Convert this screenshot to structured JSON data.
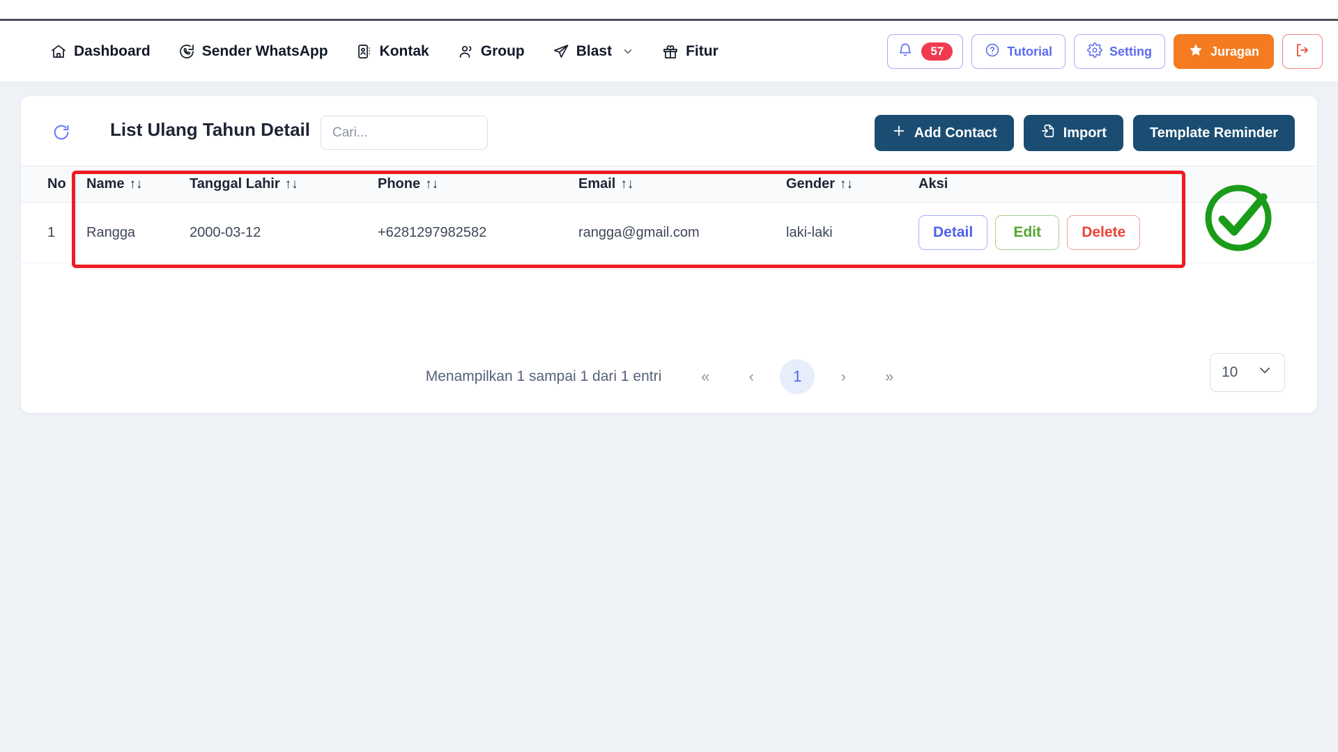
{
  "navbar": {
    "items": [
      {
        "label": "Dashboard",
        "icon": "home-icon",
        "caret": false
      },
      {
        "label": "Sender WhatsApp",
        "icon": "whatsapp-icon",
        "caret": false
      },
      {
        "label": "Kontak",
        "icon": "contact-card-icon",
        "caret": false
      },
      {
        "label": "Group",
        "icon": "people-icon",
        "caret": false
      },
      {
        "label": "Blast",
        "icon": "send-icon",
        "caret": true
      },
      {
        "label": "Fitur",
        "icon": "gift-icon",
        "caret": false
      }
    ],
    "notification": {
      "icon": "bell-icon",
      "count": "57"
    },
    "tutorial": {
      "icon": "question-circle-icon",
      "label": "Tutorial"
    },
    "setting": {
      "icon": "gear-icon",
      "label": "Setting"
    },
    "juragan": {
      "icon": "star-icon",
      "label": "Juragan"
    },
    "logout": {
      "icon": "logout-icon",
      "label": ""
    }
  },
  "toolbar": {
    "refresh_icon": "refresh-icon",
    "title": "List Ulang Tahun Detail",
    "search_placeholder": "Cari...",
    "search_value": "",
    "add_contact": "Add Contact",
    "import": "Import",
    "template_reminder": "Template Reminder"
  },
  "table": {
    "columns": [
      {
        "label": "No",
        "sortable": false
      },
      {
        "label": "Name",
        "sortable": true
      },
      {
        "label": "Tanggal Lahir",
        "sortable": true
      },
      {
        "label": "Phone",
        "sortable": true
      },
      {
        "label": "Email",
        "sortable": true
      },
      {
        "label": "Gender",
        "sortable": true
      },
      {
        "label": "Aksi",
        "sortable": false
      }
    ],
    "sort_glyph": "↑↓",
    "rows": [
      {
        "no": "1",
        "name": "Rangga",
        "tanggal_lahir": "2000-03-12",
        "phone": "+6281297982582",
        "email": "rangga@gmail.com",
        "gender": "laki-laki",
        "actions": {
          "detail": "Detail",
          "edit": "Edit",
          "delete": "Delete"
        }
      }
    ]
  },
  "pagination": {
    "summary": "Menampilkan 1 sampai 1 dari 1 entri",
    "first": "«",
    "prev": "‹",
    "current_page": "1",
    "next": "›",
    "last": "»"
  },
  "page_size": {
    "value": "10",
    "chevron_icon": "chevron-down-icon"
  },
  "annotations": {
    "highlight_box_color": "#ee1c25",
    "check_mark_color": "#1a9b1a",
    "check_icon": "check-circle-icon"
  },
  "colors": {
    "accent_blue": "#4f60ef",
    "dark_button": "#1b4d72",
    "orange": "#f47b20",
    "badge_red": "#ef3b50",
    "page_bg": "#eef1f6"
  }
}
